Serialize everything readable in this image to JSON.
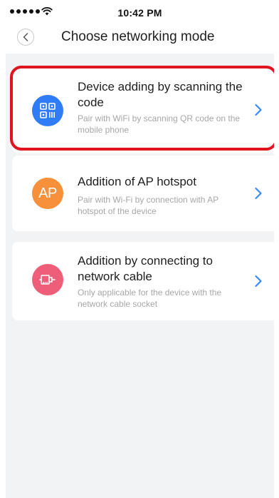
{
  "status_bar": {
    "time": "10:42 PM"
  },
  "header": {
    "title": "Choose networking mode"
  },
  "options": [
    {
      "title": "Device adding by scanning the code",
      "description": "Pair with WiFi by scanning QR code on the mobile phone",
      "icon": "qr-code-icon",
      "icon_color": "#2f7cf6"
    },
    {
      "title": "Addition of AP hotspot",
      "description": "Pair with Wi-Fi by connection with AP hotspot of the device",
      "icon_text": "AP",
      "icon_color": "#f6903a"
    },
    {
      "title": "Addition by connecting to network cable",
      "description": "Only applicable for the device with the network cable socket",
      "icon": "ethernet-plug-icon",
      "icon_color": "#ee5e78"
    }
  ],
  "colors": {
    "accent_chevron": "#3a88f7",
    "highlight_border": "#e0141e",
    "background": "#f2f3f5"
  }
}
